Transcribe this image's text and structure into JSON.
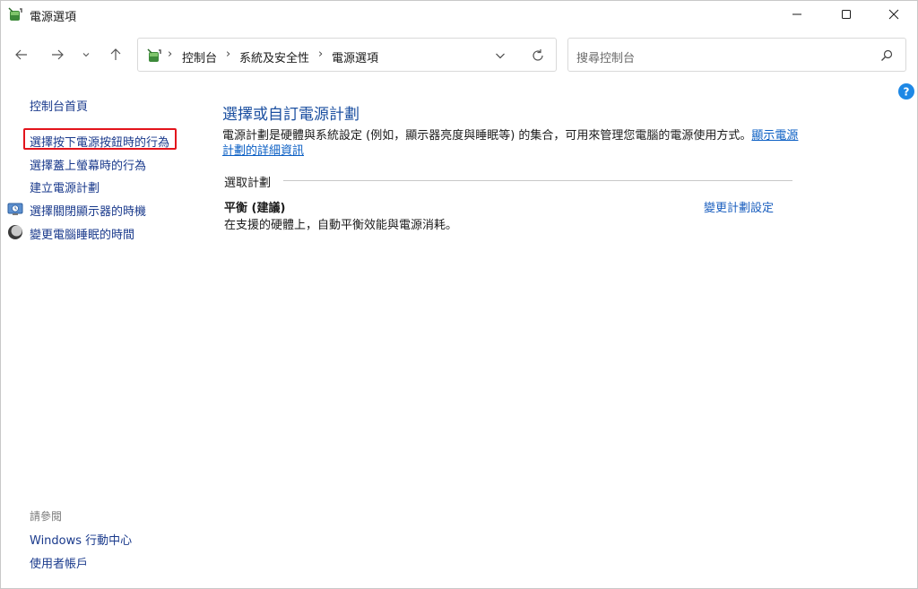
{
  "window": {
    "title": "電源選項"
  },
  "address": {
    "crumbs": [
      "控制台",
      "系統及安全性",
      "電源選項"
    ],
    "separator": "›"
  },
  "search": {
    "placeholder": "搜尋控制台"
  },
  "left_pane": {
    "home": "控制台首頁",
    "links": [
      "選擇按下電源按鈕時的行為",
      "選擇蓋上螢幕時的行為",
      "建立電源計劃",
      "選擇關閉顯示器的時機",
      "變更電腦睡眠的時間"
    ],
    "see_also_title": "請參閱",
    "see_also": [
      "Windows 行動中心",
      "使用者帳戶"
    ]
  },
  "main": {
    "title": "選擇或自訂電源計劃",
    "description": "電源計劃是硬體與系統設定 (例如，顯示器亮度與睡眠等) 的集合，可用來管理您電腦的電源使用方式。",
    "description_link": "顯示電源計劃的詳細資訊",
    "section_label": "選取計劃",
    "plan": {
      "name": "平衡 (建議)",
      "description": "在支援的硬體上，自動平衡效能與電源消耗。",
      "change_link": "變更計劃設定"
    }
  },
  "colors": {
    "link": "#1b5fbf",
    "highlight": "#e3141c",
    "help": "#1e88e5"
  },
  "icons": [
    "power-options-icon",
    "back-arrow-icon",
    "forward-arrow-icon",
    "recent-chevron-icon",
    "up-arrow-icon",
    "dropdown-chevron-icon",
    "refresh-icon",
    "search-icon",
    "help-icon",
    "display-icon",
    "sleep-icon",
    "minimize-icon",
    "maximize-icon",
    "close-icon"
  ]
}
